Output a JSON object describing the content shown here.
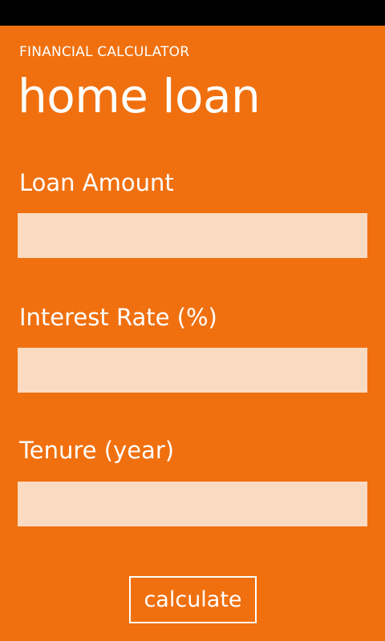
{
  "app": {
    "title": "FINANCIAL CALCULATOR",
    "page_title": "home loan"
  },
  "form": {
    "loan_amount": {
      "label": "Loan Amount",
      "value": ""
    },
    "interest_rate": {
      "label": "Interest Rate (%)",
      "value": ""
    },
    "tenure": {
      "label": "Tenure (year)",
      "value": ""
    }
  },
  "actions": {
    "calculate_label": "calculate"
  },
  "colors": {
    "accent": "#f0700f",
    "input_background": "#fbdac2",
    "status_bar": "#000000",
    "text": "#ffffff"
  }
}
